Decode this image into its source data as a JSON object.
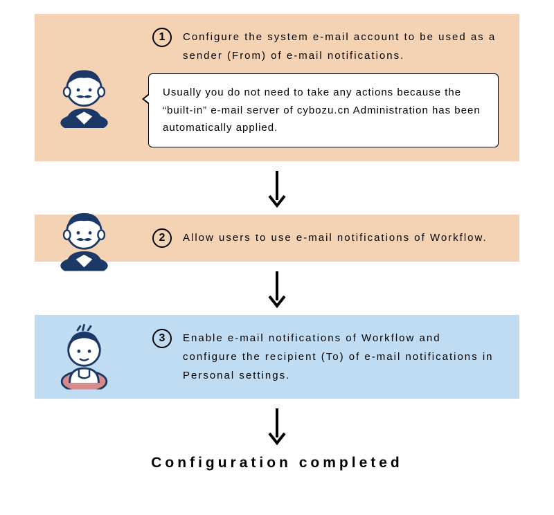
{
  "steps": [
    {
      "number": "1",
      "text": "Configure the system e-mail account to be used as a sender (From) of e-mail notifications.",
      "callout": "Usually you do not need to take any actions because the “built-in” e-mail server of cybozu.cn Administration has been automatically applied."
    },
    {
      "number": "2",
      "text": "Allow users to use e-mail notifications of Workflow."
    },
    {
      "number": "3",
      "text": "Enable e-mail notifications of Workflow and configure the recipient (To) of e-mail notifications in Personal settings."
    }
  ],
  "completed_label": "Configuration completed"
}
